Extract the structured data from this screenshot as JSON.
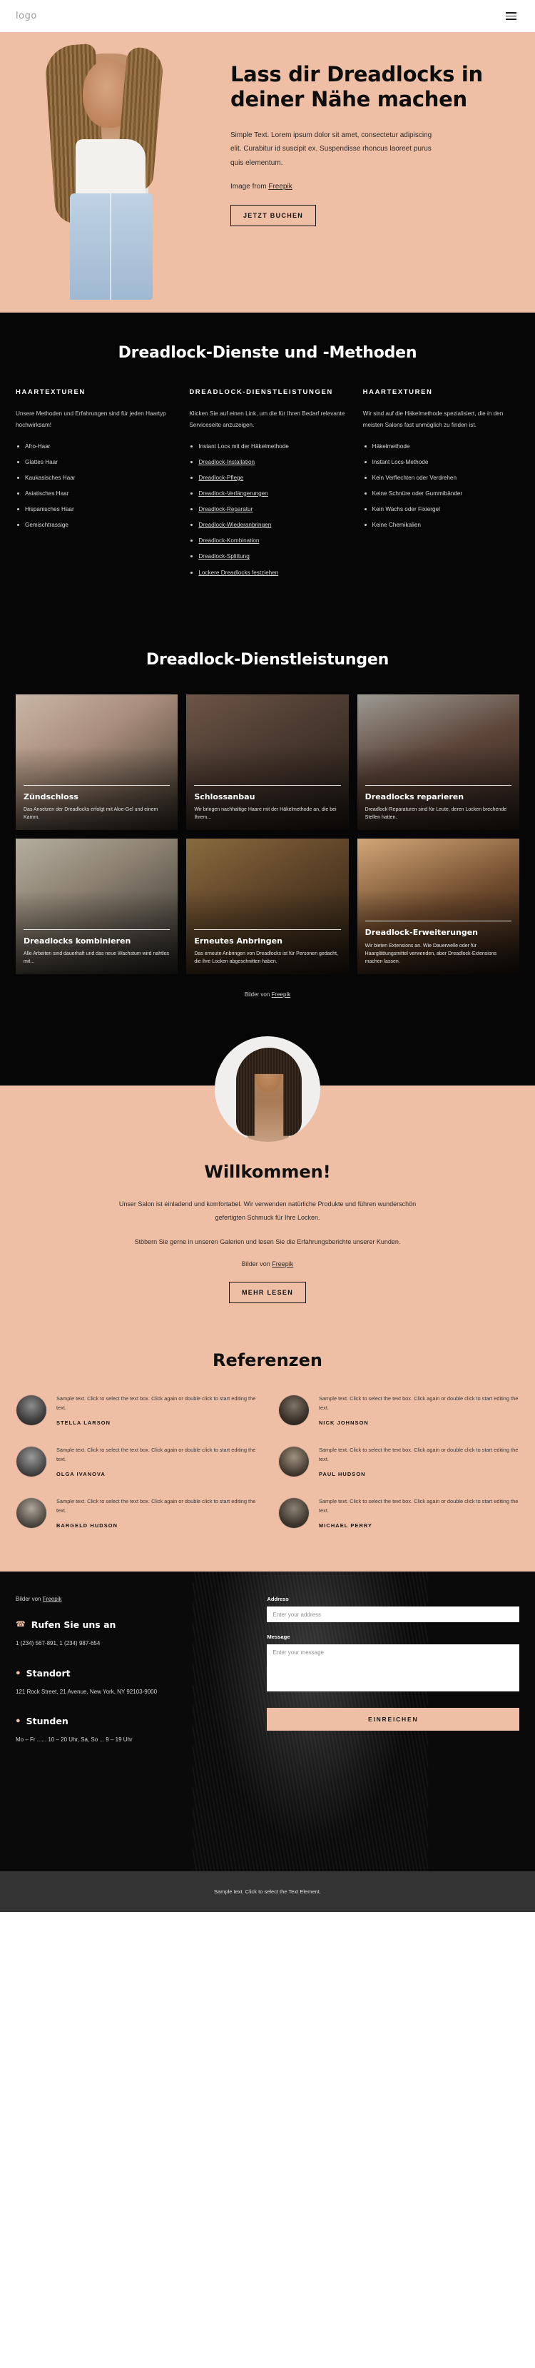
{
  "header": {
    "logo": "logo",
    "menu_icon": "hamburger-menu-icon"
  },
  "hero": {
    "title": "Lass dir Dreadlocks in deiner Nähe machen",
    "paragraph": "Simple Text. Lorem ipsum dolor sit amet, consectetur adipiscing elit. Curabitur id suscipit ex. Suspendisse rhoncus laoreet purus quis elementum.",
    "credit_prefix": "Image from ",
    "credit_link": "Freepik",
    "cta": "JETZT BUCHEN"
  },
  "methods": {
    "title": "Dreadlock-Dienste und -Methoden",
    "columns": [
      {
        "heading": "HAARTEXTUREN",
        "text": "Unsere Methoden und Erfahrungen sind für jeden Haartyp hochwirksam!",
        "items": [
          {
            "label": "Afro-Haar",
            "link": false
          },
          {
            "label": "Glattes Haar",
            "link": false
          },
          {
            "label": "Kaukasisches Haar",
            "link": false
          },
          {
            "label": "Asiatisches Haar",
            "link": false
          },
          {
            "label": "Hispanisches Haar",
            "link": false
          },
          {
            "label": "Gemischtrassige",
            "link": false
          }
        ]
      },
      {
        "heading": "DREADLOCK-DIENSTLEISTUNGEN",
        "text": "Klicken Sie auf einen Link, um die für Ihren Bedarf relevante Serviceseite anzuzeigen.",
        "items": [
          {
            "label": "Instant Locs mit der Häkelmethode",
            "link": false
          },
          {
            "label": "Dreadlock-Installation",
            "link": true
          },
          {
            "label": "Dreadlock-Pflege",
            "link": true
          },
          {
            "label": "Dreadlock-Verlängerungen",
            "link": true
          },
          {
            "label": "Dreadlock-Reparatur",
            "link": true
          },
          {
            "label": "Dreadlock-Wiederanbringen",
            "link": true
          },
          {
            "label": "Dreadlock-Kombination",
            "link": true
          },
          {
            "label": "Dreadlock-Splittung",
            "link": true
          },
          {
            "label": "Lockere Dreadlocks festziehen",
            "link": true
          }
        ]
      },
      {
        "heading": "HAARTEXTUREN",
        "text": "Wir sind auf die Häkelmethode spezialisiert, die in den meisten Salons fast unmöglich zu finden ist.",
        "items": [
          {
            "label": "Häkelmethode",
            "link": false
          },
          {
            "label": "Instant Locs-Methode",
            "link": false
          },
          {
            "label": "Kein Verflechten oder Verdrehen",
            "link": false
          },
          {
            "label": "Keine Schnüre oder Gummibänder",
            "link": false
          },
          {
            "label": "Kein Wachs oder Fixiergel",
            "link": false
          },
          {
            "label": "Keine Chemikalien",
            "link": false
          }
        ]
      }
    ]
  },
  "gallery": {
    "title": "Dreadlock-Dienstleistungen",
    "cards": [
      {
        "title": "Zündschloss",
        "desc": "Das Ansetzen der Dreadlocks erfolgt mit Aloe-Gel und einem Kamm."
      },
      {
        "title": "Schlossanbau",
        "desc": "Wir bringen nachhaltige Haare mit der Häkelmethode an, die bei Ihrem..."
      },
      {
        "title": "Dreadlocks reparieren",
        "desc": "Dreadlock-Reparaturen sind für Leute, deren Locken brechende Stellen hatten."
      },
      {
        "title": "Dreadlocks kombinieren",
        "desc": "Alle Arbeiten sind dauerhaft und das neue Wachstum wird nahtlos mit..."
      },
      {
        "title": "Erneutes Anbringen",
        "desc": "Das erneute Anbringen von Dreadlocks ist für Personen gedacht, die ihre Locken abgeschnitten haben."
      },
      {
        "title": "Dreadlock-Erweiterungen",
        "desc": "Wir bieten Extensions an. Wie Dauerwelle oder für Haarglättungsmittel verwenden, aber Dreadlock-Extensions machen lassen."
      }
    ],
    "credit_prefix": "Bilder von ",
    "credit_link": "Freepik"
  },
  "welcome": {
    "title": "Willkommen!",
    "paragraph1": "Unser Salon ist einladend und komfortabel. Wir verwenden natürliche Produkte und führen wunderschön gefertigten Schmuck für Ihre Locken.",
    "paragraph2": "Stöbern Sie gerne in unseren Galerien und lesen Sie die Erfahrungsberichte unserer Kunden.",
    "credit_prefix": "Bilder von ",
    "credit_link": "Freepik",
    "cta": "MEHR LESEN"
  },
  "testimonials": {
    "title": "Referenzen",
    "items": [
      {
        "quote": "Sample text. Click to select the text box. Click again or double click to start editing the text.",
        "name": "STELLA LARSON"
      },
      {
        "quote": "Sample text. Click to select the text box. Click again or double click to start editing the text.",
        "name": "NICK JOHNSON"
      },
      {
        "quote": "Sample text. Click to select the text box. Click again or double click to start editing the text.",
        "name": "OLGA IVANOVA"
      },
      {
        "quote": "Sample text. Click to select the text box. Click again or double click to start editing the text.",
        "name": "PAUL HUDSON"
      },
      {
        "quote": "Sample text. Click to select the text box. Click again or double click to start editing the text.",
        "name": "BARGELD HUDSON"
      },
      {
        "quote": "Sample text. Click to select the text box. Click again or double click to start editing the text.",
        "name": "MICHAEL PERRY"
      }
    ]
  },
  "contact": {
    "credit_prefix": "Bilder von ",
    "credit_link": "Freepik",
    "phone_icon": "phone-icon",
    "phone_label": "Rufen Sie uns an",
    "phone_value": "1 (234) 567-891, 1 (234) 987-654",
    "location_icon": "map-pin-icon",
    "location_label": "Standort",
    "location_value": "121 Rock Street, 21 Avenue, New York, NY 92103-9000",
    "hours_icon": "clock-icon",
    "hours_label": "Stunden",
    "hours_value": "Mo – Fr ...... 10 – 20 Uhr, Sa, So ... 9 – 19 Uhr",
    "form": {
      "address_label": "Address",
      "address_placeholder": "Enter your address",
      "message_label": "Message",
      "message_placeholder": "Enter your message",
      "submit": "EINREICHEN"
    }
  },
  "footer": {
    "text": "Sample text. Click to select the Text Element."
  },
  "colors": {
    "accent": "#eebfa5",
    "dark": "#060606",
    "bottombar": "#333333"
  }
}
